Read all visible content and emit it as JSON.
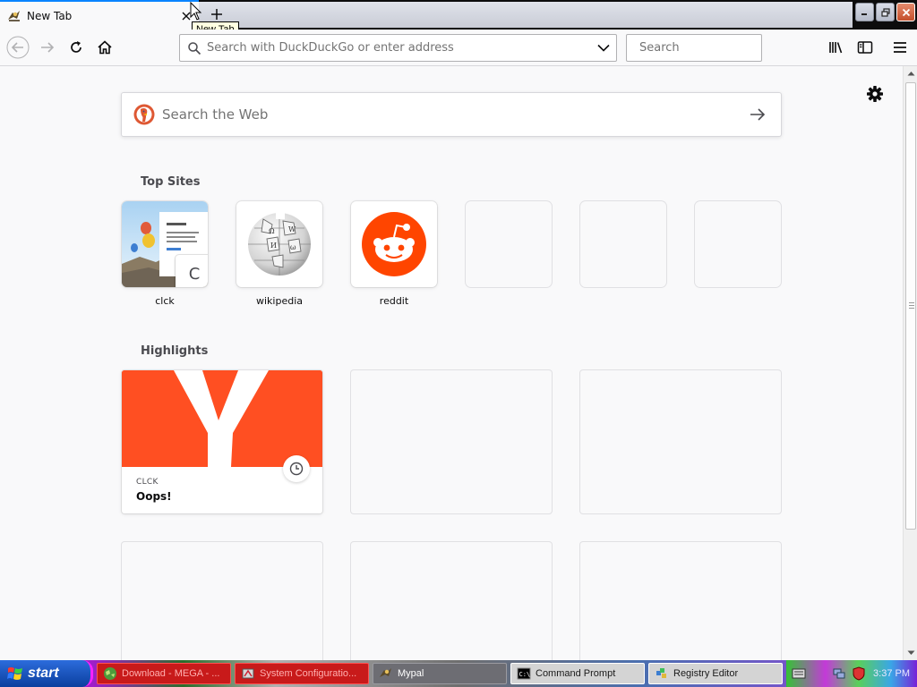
{
  "window": {
    "tab_title": "New Tab",
    "new_tab_tooltip": "New Tab"
  },
  "navbar": {
    "url_placeholder": "Search with DuckDuckGo or enter address",
    "search_placeholder": "Search"
  },
  "newtab": {
    "web_search_placeholder": "Search the Web",
    "top_sites_heading": "Top Sites",
    "top_sites": [
      {
        "label": "clck",
        "letter": "C"
      },
      {
        "label": "wikipedia"
      },
      {
        "label": "reddit"
      }
    ],
    "highlights_heading": "Highlights",
    "highlights": [
      {
        "source": "CLCK",
        "title": "Oops!"
      }
    ]
  },
  "taskbar": {
    "start_label": "start",
    "items": [
      {
        "label": "Download - MEGA - ..."
      },
      {
        "label": "System Configuratio..."
      },
      {
        "label": "Mypal"
      },
      {
        "label": "Command Prompt"
      },
      {
        "label": "Registry Editor"
      }
    ],
    "clock": "3:37 PM"
  },
  "colors": {
    "accent": "#0a84ff",
    "reddit": "#ff4500",
    "yandex": "#ff4f22",
    "ddg": "#de5833"
  }
}
